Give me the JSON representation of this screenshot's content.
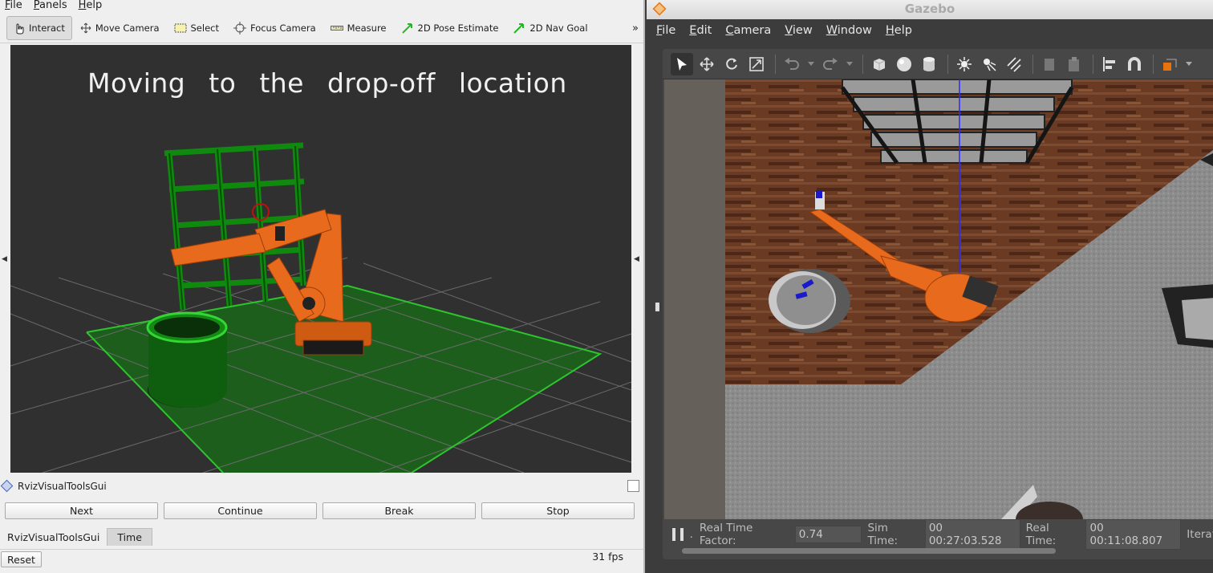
{
  "rviz": {
    "menu": [
      "File",
      "Panels",
      "Help"
    ],
    "tools": [
      {
        "label": "Interact",
        "icon": "hand-pointer-icon",
        "active": true
      },
      {
        "label": "Move Camera",
        "icon": "move-camera-icon"
      },
      {
        "label": "Select",
        "icon": "select-rect-icon"
      },
      {
        "label": "Focus Camera",
        "icon": "focus-camera-icon"
      },
      {
        "label": "Measure",
        "icon": "ruler-icon"
      },
      {
        "label": "2D Pose Estimate",
        "icon": "green-arrow-icon"
      },
      {
        "label": "2D Nav Goal",
        "icon": "green-arrow-icon"
      }
    ],
    "overflow": "»",
    "overlay_text": "Moving to the drop-off location",
    "panel_title": "RvizVisualToolsGui",
    "buttons": [
      "Next",
      "Continue",
      "Break",
      "Stop"
    ],
    "tabs": [
      "RvizVisualToolsGui",
      "Time"
    ],
    "reset_label": "Reset",
    "fps": "31 fps"
  },
  "gazebo": {
    "title": "Gazebo",
    "menu": [
      "File",
      "Edit",
      "Camera",
      "View",
      "Window",
      "Help"
    ],
    "status": {
      "real_time_factor_label": "Real Time Factor:",
      "real_time_factor": "0.74",
      "sim_time_label": "Sim Time:",
      "sim_time": "00 00:27:03.528",
      "real_time_label": "Real Time:",
      "real_time": "00 00:11:08.807",
      "iterations_label": "Iterat"
    }
  },
  "colors": {
    "robot": "#e86a1c",
    "grid_green": "#1f6b1f",
    "gazebo_bg": "#3c3c3c"
  }
}
